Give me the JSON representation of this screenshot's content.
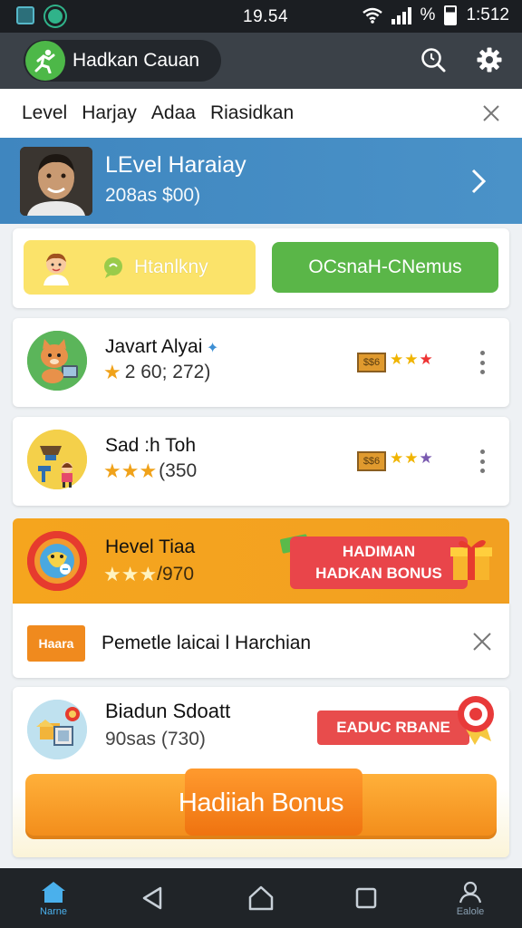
{
  "status_bar": {
    "time_center": "19.54",
    "battery_text": "%",
    "time_right": "1:512"
  },
  "app_bar": {
    "title": "Hadkan Cauan",
    "accent_color": "#4db848"
  },
  "tabs": [
    {
      "label": "Level"
    },
    {
      "label": "Harjay"
    },
    {
      "label": "Adaa"
    },
    {
      "label": "Riasidkan"
    }
  ],
  "profile": {
    "name": "LEvel Haraiay",
    "subtitle": "208as $00)"
  },
  "quick_actions": {
    "left_label": "Htanlkny",
    "right_label": "OCsnaH-CNemus"
  },
  "games": [
    {
      "title": "Javart Alyai",
      "rating_text": "2 60; 272)",
      "star_count": 1,
      "badge": "$$6"
    },
    {
      "title": "Sad :h Toh",
      "rating_text": "(350",
      "star_count": 3,
      "badge": "$$6"
    }
  ],
  "promo": {
    "title": "Hevel Tiaa",
    "rating_text": "/970",
    "button_line1": "HADIMAN",
    "button_line2": "HADKAN BONUS",
    "color": "#f5a51e"
  },
  "notice": {
    "logo_text": "Haara",
    "text": "Pemetle laicai l Harchian"
  },
  "bonus_card": {
    "title": "Biadun Sdoatt",
    "subtitle": "90sas (730)",
    "tag_label": "EADUC RBANE",
    "button_label": "Hadiiah Bonus"
  },
  "nav": {
    "home_label": "Narne",
    "profile_label": "Ealole"
  }
}
